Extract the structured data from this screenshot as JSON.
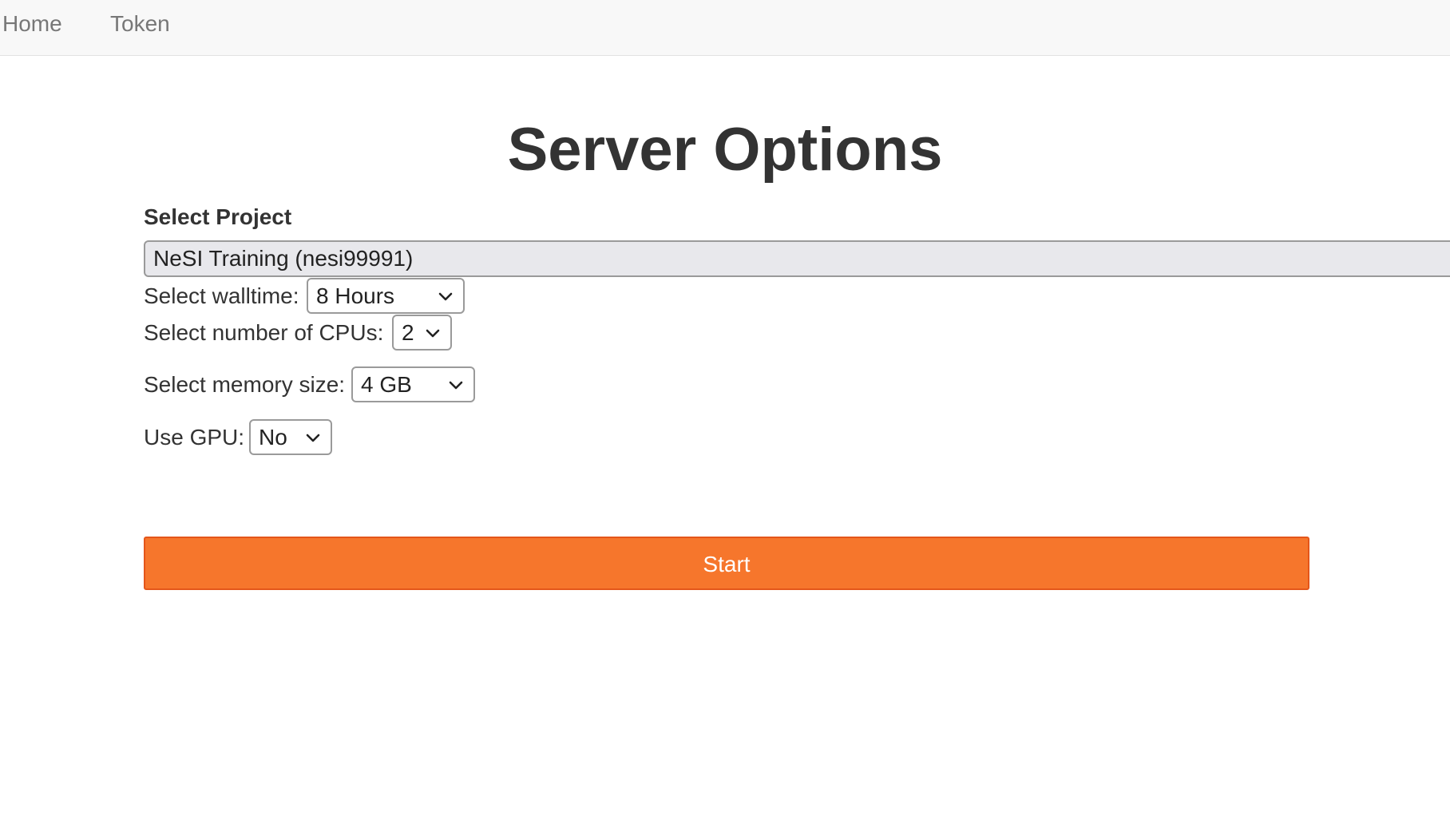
{
  "nav": {
    "home_label": "Home",
    "token_label": "Token"
  },
  "page": {
    "title": "Server Options"
  },
  "project": {
    "label": "Select Project",
    "selected": "NeSI Training (nesi99991)"
  },
  "walltime": {
    "label": "Select walltime:",
    "selected": "8 Hours"
  },
  "cpus": {
    "label": "Select number of CPUs:",
    "selected": "2"
  },
  "memory": {
    "label": "Select memory size:",
    "selected": "4 GB"
  },
  "gpu": {
    "label": "Use GPU:",
    "selected": "No"
  },
  "start": {
    "label": "Start"
  },
  "icons": {
    "dropdown": "chevron-down-icon"
  },
  "colors": {
    "start_button": "#f6762c",
    "start_border": "#e4561a",
    "navbar_bg": "#f8f8f8",
    "nav_text": "#777777"
  }
}
